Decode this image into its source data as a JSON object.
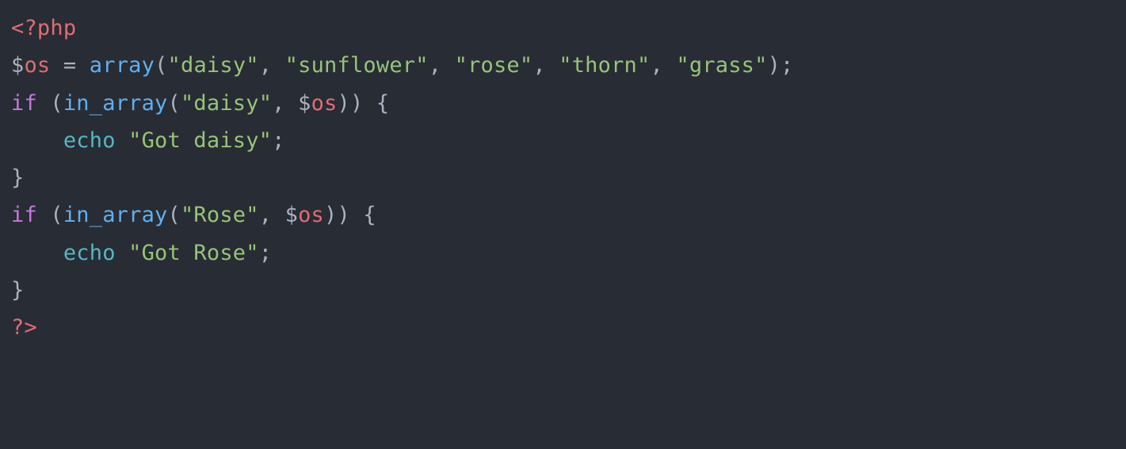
{
  "code": {
    "lines": [
      {
        "tokens": [
          {
            "cls": "tok-phpopen",
            "text": "<?php"
          }
        ]
      },
      {
        "tokens": [
          {
            "cls": "tok-punc",
            "text": "$"
          },
          {
            "cls": "tok-var",
            "text": "os"
          },
          {
            "cls": "tok-punc",
            "text": " "
          },
          {
            "cls": "tok-op",
            "text": "="
          },
          {
            "cls": "tok-punc",
            "text": " "
          },
          {
            "cls": "tok-func",
            "text": "array"
          },
          {
            "cls": "tok-punc",
            "text": "("
          },
          {
            "cls": "tok-str",
            "text": "\"daisy\""
          },
          {
            "cls": "tok-punc",
            "text": ", "
          },
          {
            "cls": "tok-str",
            "text": "\"sunflower\""
          },
          {
            "cls": "tok-punc",
            "text": ", "
          },
          {
            "cls": "tok-str",
            "text": "\"rose\""
          },
          {
            "cls": "tok-punc",
            "text": ", "
          },
          {
            "cls": "tok-str",
            "text": "\"thorn\""
          },
          {
            "cls": "tok-punc",
            "text": ", "
          },
          {
            "cls": "tok-str",
            "text": "\"grass\""
          },
          {
            "cls": "tok-punc",
            "text": ");"
          }
        ]
      },
      {
        "tokens": [
          {
            "cls": "tok-kw",
            "text": "if"
          },
          {
            "cls": "tok-punc",
            "text": " ("
          },
          {
            "cls": "tok-func",
            "text": "in_array"
          },
          {
            "cls": "tok-punc",
            "text": "("
          },
          {
            "cls": "tok-str",
            "text": "\"daisy\""
          },
          {
            "cls": "tok-punc",
            "text": ", "
          },
          {
            "cls": "tok-punc",
            "text": "$"
          },
          {
            "cls": "tok-var",
            "text": "os"
          },
          {
            "cls": "tok-punc",
            "text": ")) {"
          }
        ]
      },
      {
        "tokens": [
          {
            "cls": "tok-punc",
            "text": "    "
          },
          {
            "cls": "tok-echo",
            "text": "echo"
          },
          {
            "cls": "tok-punc",
            "text": " "
          },
          {
            "cls": "tok-str",
            "text": "\"Got daisy\""
          },
          {
            "cls": "tok-punc",
            "text": ";"
          }
        ]
      },
      {
        "tokens": [
          {
            "cls": "tok-punc",
            "text": "}"
          }
        ]
      },
      {
        "tokens": [
          {
            "cls": "tok-kw",
            "text": "if"
          },
          {
            "cls": "tok-punc",
            "text": " ("
          },
          {
            "cls": "tok-func",
            "text": "in_array"
          },
          {
            "cls": "tok-punc",
            "text": "("
          },
          {
            "cls": "tok-str",
            "text": "\"Rose\""
          },
          {
            "cls": "tok-punc",
            "text": ", "
          },
          {
            "cls": "tok-punc",
            "text": "$"
          },
          {
            "cls": "tok-var",
            "text": "os"
          },
          {
            "cls": "tok-punc",
            "text": ")) {"
          }
        ]
      },
      {
        "tokens": [
          {
            "cls": "tok-punc",
            "text": "    "
          },
          {
            "cls": "tok-echo",
            "text": "echo"
          },
          {
            "cls": "tok-punc",
            "text": " "
          },
          {
            "cls": "tok-str",
            "text": "\"Got Rose\""
          },
          {
            "cls": "tok-punc",
            "text": ";"
          }
        ]
      },
      {
        "tokens": [
          {
            "cls": "tok-punc",
            "text": "}"
          }
        ]
      },
      {
        "tokens": [
          {
            "cls": "tok-phpclose",
            "text": "?>"
          }
        ]
      }
    ]
  }
}
